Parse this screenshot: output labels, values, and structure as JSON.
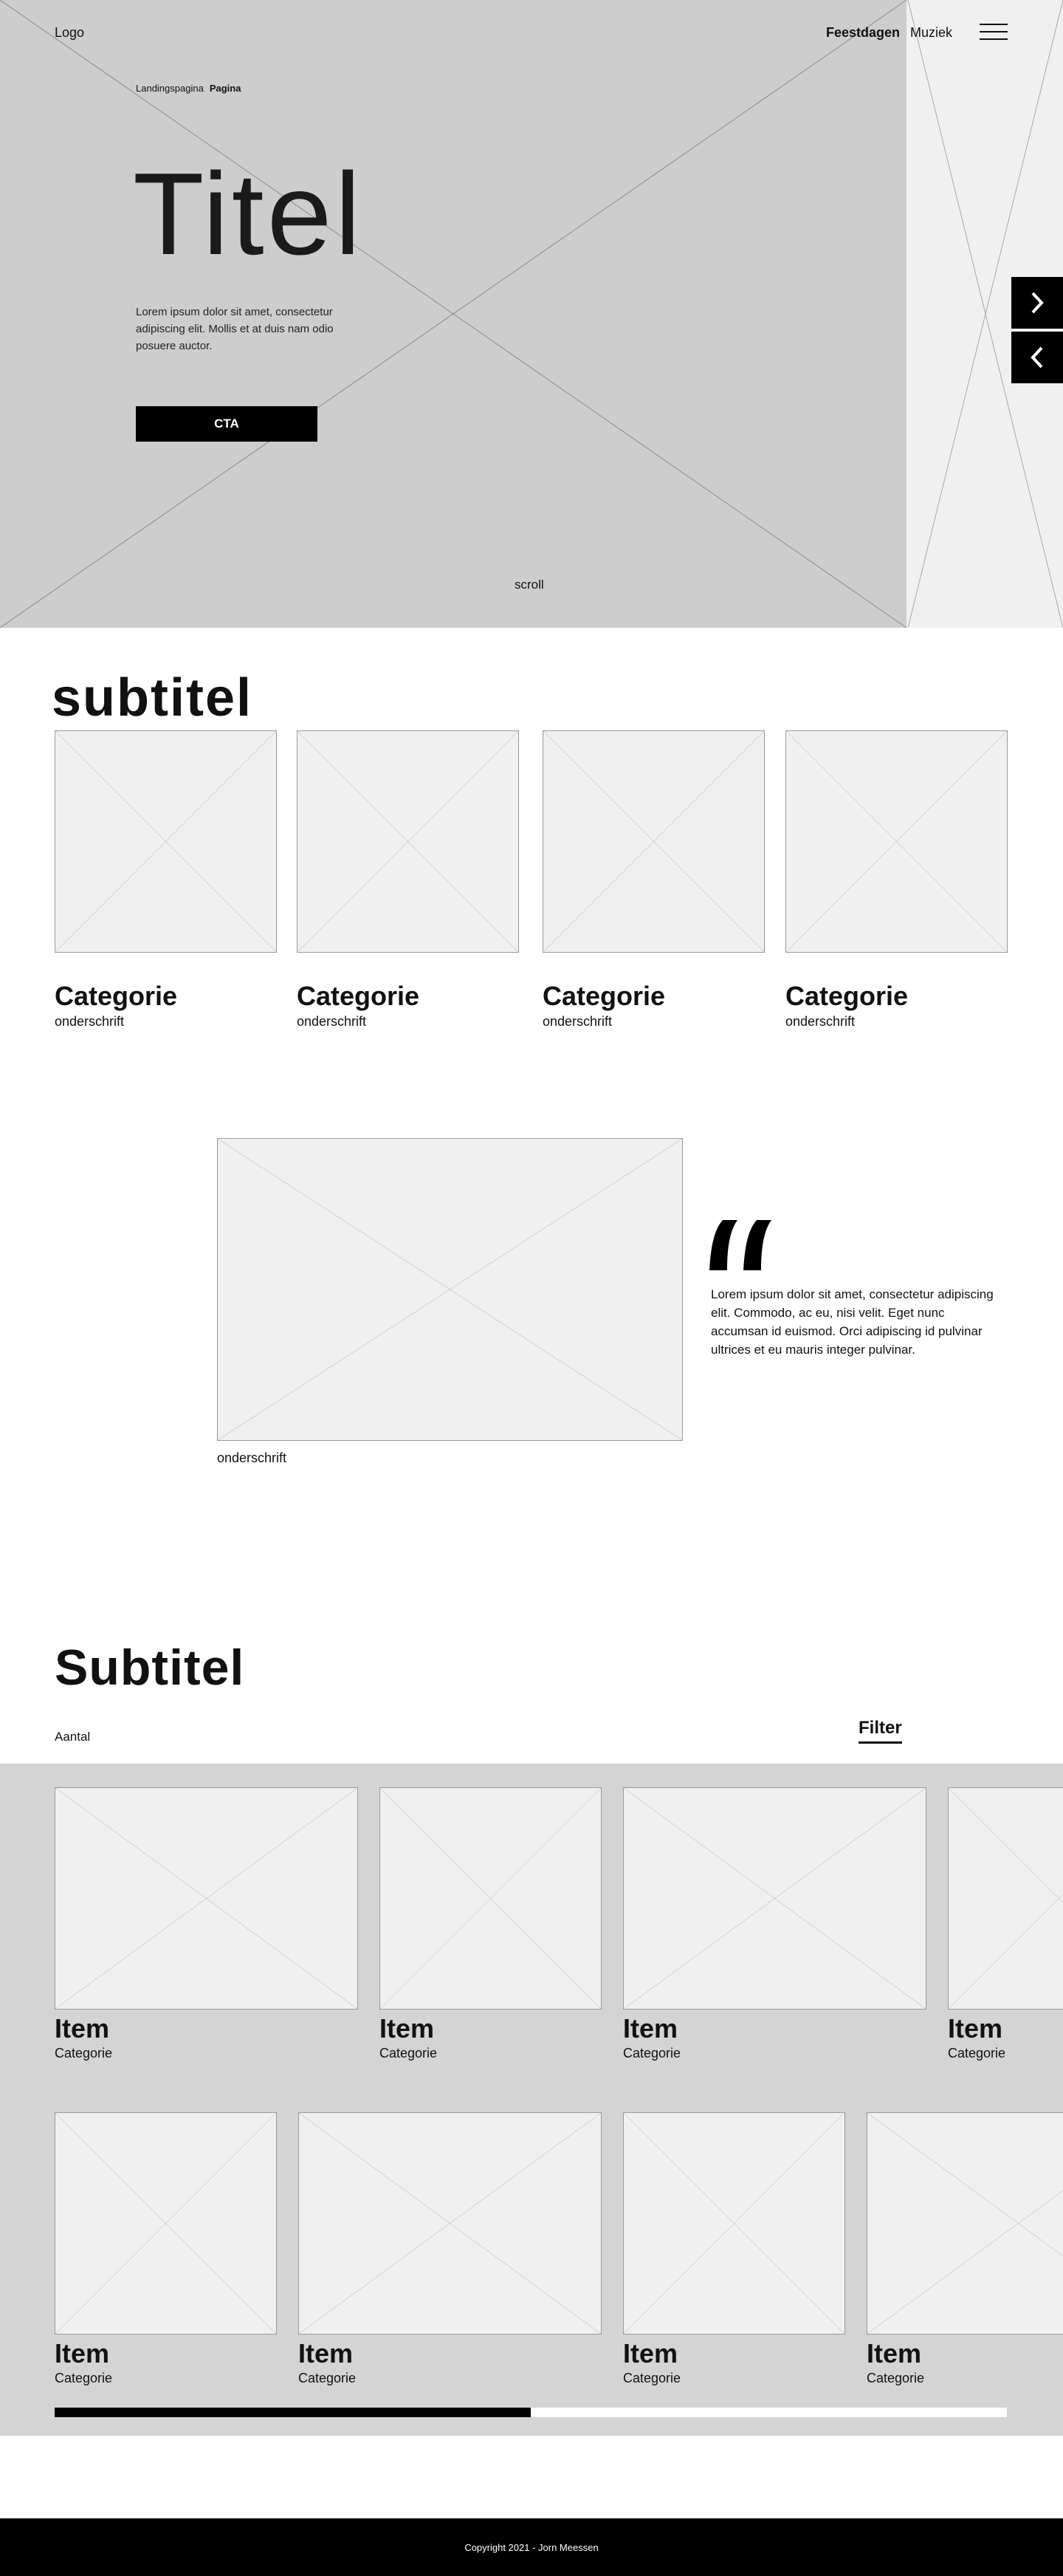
{
  "header": {
    "logo": "Logo",
    "nav": [
      "Feestdagen",
      "Muziek"
    ],
    "menu_icon": "hamburger-menu-icon"
  },
  "hero": {
    "breadcrumb": [
      "Landingspagina",
      "Pagina"
    ],
    "title": "Titel",
    "text": "Lorem ipsum dolor sit amet, consectetur adipiscing elit. Mollis et at duis nam odio posuere auctor.",
    "cta": "CTA",
    "scroll": "scroll",
    "next_icon": "chevron-right-icon",
    "prev_icon": "chevron-left-icon"
  },
  "categories": {
    "subtitle": "subtitel",
    "items": [
      {
        "title": "Categorie",
        "sub": "onderschrift"
      },
      {
        "title": "Categorie",
        "sub": "onderschrift"
      },
      {
        "title": "Categorie",
        "sub": "onderschrift"
      },
      {
        "title": "Categorie",
        "sub": "onderschrift"
      }
    ]
  },
  "quote": {
    "icon": "quote-icon",
    "text": "Lorem ipsum dolor sit amet, consectetur adipiscing elit. Commodo, ac eu, nisi velit. Eget nunc accumsan id euismod. Orci adipiscing id pulvinar ultrices et eu mauris integer pulvinar.",
    "caption": "onderschrift"
  },
  "items_section": {
    "subtitle": "Subtitel",
    "count_label": "Aantal",
    "filter_label": "Filter",
    "row1": [
      {
        "title": "Item",
        "category": "Categorie"
      },
      {
        "title": "Item",
        "category": "Categorie"
      },
      {
        "title": "Item",
        "category": "Categorie"
      },
      {
        "title": "Item",
        "category": "Categorie"
      }
    ],
    "row2": [
      {
        "title": "Item",
        "category": "Categorie"
      },
      {
        "title": "Item",
        "category": "Categorie"
      },
      {
        "title": "Item",
        "category": "Categorie"
      },
      {
        "title": "Item",
        "category": "Categorie"
      }
    ],
    "scroll_progress": 0.5
  },
  "footer": {
    "copyright": "Copyright 2021 - Jorn Meessen"
  },
  "colors": {
    "hero_bg": "#cdcdcd",
    "placeholder_bg": "#f0f0f0",
    "band_bg": "#d4d4d4",
    "accent": "#000000"
  }
}
